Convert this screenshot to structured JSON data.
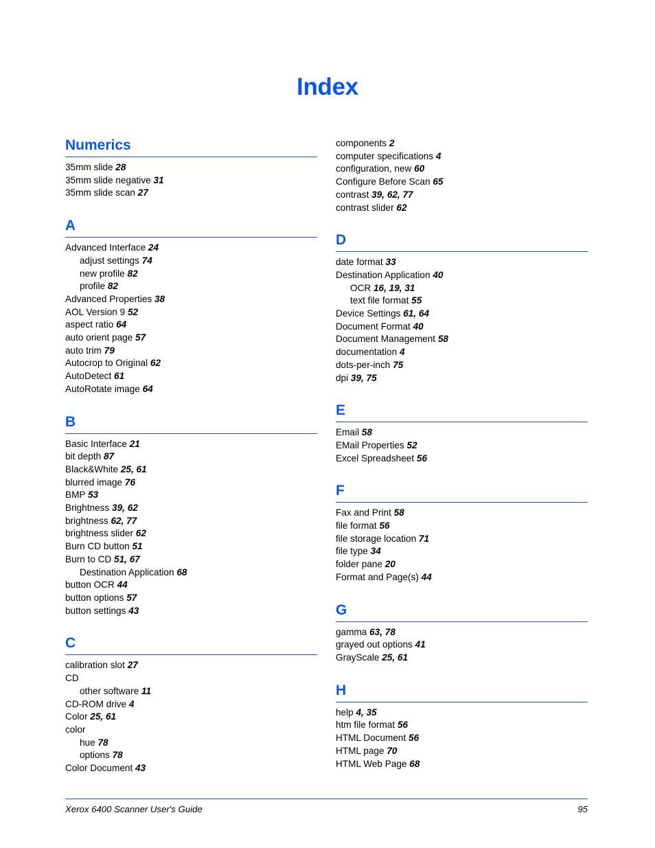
{
  "document": {
    "title": "Index",
    "page_number": "95",
    "footer_text": "Xerox 6400 Scanner User's Guide",
    "accent_color": "#0C57E0",
    "rule_color": "#1056C8",
    "text_color": "#000000"
  },
  "columns": [
    {
      "name": "left-column",
      "sections": [
        {
          "letter": "Numerics",
          "continuation": false,
          "entries": [
            {
              "term": "35mm slide",
              "pages": "28",
              "sub": false
            },
            {
              "term": "35mm slide negative",
              "pages": "31",
              "sub": false
            },
            {
              "term": "35mm slide scan",
              "pages": "27",
              "sub": false
            }
          ]
        },
        {
          "letter": "A",
          "continuation": false,
          "entries": [
            {
              "term": "Advanced Interface",
              "pages": "24",
              "sub": false
            },
            {
              "term": "adjust settings",
              "pages": "74",
              "sub": true
            },
            {
              "term": "new profile",
              "pages": "82",
              "sub": true
            },
            {
              "term": "profile",
              "pages": "82",
              "sub": true
            },
            {
              "term": "Advanced Properties",
              "pages": "38",
              "sub": false
            },
            {
              "term": "AOL Version 9",
              "pages": "52",
              "sub": false
            },
            {
              "term": "aspect ratio",
              "pages": "64",
              "sub": false
            },
            {
              "term": "auto orient page",
              "pages": "57",
              "sub": false
            },
            {
              "term": "auto trim",
              "pages": "79",
              "sub": false
            },
            {
              "term": "Autocrop to Original",
              "pages": "62",
              "sub": false
            },
            {
              "term": "AutoDetect",
              "pages": "61",
              "sub": false
            },
            {
              "term": "AutoRotate image",
              "pages": "64",
              "sub": false
            }
          ]
        },
        {
          "letter": "B",
          "continuation": false,
          "entries": [
            {
              "term": "Basic Interface",
              "pages": "21",
              "sub": false
            },
            {
              "term": "bit depth",
              "pages": "87",
              "sub": false
            },
            {
              "term": "Black&White",
              "pages": "25, 61",
              "sub": false
            },
            {
              "term": "blurred image",
              "pages": "76",
              "sub": false
            },
            {
              "term": "BMP",
              "pages": "53",
              "sub": false
            },
            {
              "term": "Brightness",
              "pages": "39, 62",
              "sub": false
            },
            {
              "term": "brightness",
              "pages": "62, 77",
              "sub": false
            },
            {
              "term": "brightness slider",
              "pages": "62",
              "sub": false
            },
            {
              "term": "Burn CD button",
              "pages": "51",
              "sub": false
            },
            {
              "term": "Burn to CD",
              "pages": "51, 67",
              "sub": false
            },
            {
              "term": "Destination Application",
              "pages": "68",
              "sub": true
            },
            {
              "term": "button OCR",
              "pages": "44",
              "sub": false
            },
            {
              "term": "button options",
              "pages": "57",
              "sub": false
            },
            {
              "term": "button settings",
              "pages": "43",
              "sub": false
            }
          ]
        },
        {
          "letter": "C",
          "continuation": false,
          "entries": [
            {
              "term": "calibration slot",
              "pages": "27",
              "sub": false
            },
            {
              "term": "CD",
              "pages": "",
              "sub": false
            },
            {
              "term": "other software",
              "pages": "11",
              "sub": true
            },
            {
              "term": "CD-ROM drive",
              "pages": "4",
              "sub": false
            },
            {
              "term": "Color",
              "pages": "25, 61",
              "sub": false
            },
            {
              "term": "color",
              "pages": "",
              "sub": false
            },
            {
              "term": "hue",
              "pages": "78",
              "sub": true
            },
            {
              "term": "options",
              "pages": "78",
              "sub": true
            },
            {
              "term": "Color Document",
              "pages": "43",
              "sub": false
            }
          ]
        }
      ]
    },
    {
      "name": "right-column",
      "sections": [
        {
          "letter": "",
          "continuation": true,
          "entries": [
            {
              "term": "components",
              "pages": "2",
              "sub": false
            },
            {
              "term": "computer specifications",
              "pages": "4",
              "sub": false
            },
            {
              "term": "configuration, new",
              "pages": "60",
              "sub": false
            },
            {
              "term": "Configure Before Scan",
              "pages": "65",
              "sub": false
            },
            {
              "term": "contrast",
              "pages": "39, 62, 77",
              "sub": false
            },
            {
              "term": "contrast slider",
              "pages": "62",
              "sub": false
            }
          ]
        },
        {
          "letter": "D",
          "continuation": false,
          "entries": [
            {
              "term": "date format",
              "pages": "33",
              "sub": false
            },
            {
              "term": "Destination Application",
              "pages": "40",
              "sub": false
            },
            {
              "term": "OCR",
              "pages": "16, 19, 31",
              "sub": true
            },
            {
              "term": "text file format",
              "pages": "55",
              "sub": true
            },
            {
              "term": "Device Settings",
              "pages": "61, 64",
              "sub": false
            },
            {
              "term": "Document Format",
              "pages": "40",
              "sub": false
            },
            {
              "term": "Document Management",
              "pages": "58",
              "sub": false
            },
            {
              "term": "documentation",
              "pages": "4",
              "sub": false
            },
            {
              "term": "dots-per-inch",
              "pages": "75",
              "sub": false
            },
            {
              "term": "dpi",
              "pages": "39, 75",
              "sub": false
            }
          ]
        },
        {
          "letter": "E",
          "continuation": false,
          "entries": [
            {
              "term": "Email",
              "pages": "58",
              "sub": false
            },
            {
              "term": "EMail Properties",
              "pages": "52",
              "sub": false
            },
            {
              "term": "Excel Spreadsheet",
              "pages": "56",
              "sub": false
            }
          ]
        },
        {
          "letter": "F",
          "continuation": false,
          "entries": [
            {
              "term": "Fax and Print",
              "pages": "58",
              "sub": false
            },
            {
              "term": "file format",
              "pages": "56",
              "sub": false
            },
            {
              "term": "file storage location",
              "pages": "71",
              "sub": false
            },
            {
              "term": "file type",
              "pages": "34",
              "sub": false
            },
            {
              "term": "folder pane",
              "pages": "20",
              "sub": false
            },
            {
              "term": "Format and Page(s)",
              "pages": "44",
              "sub": false
            }
          ]
        },
        {
          "letter": "G",
          "continuation": false,
          "entries": [
            {
              "term": "gamma",
              "pages": "63, 78",
              "sub": false
            },
            {
              "term": "grayed out options",
              "pages": "41",
              "sub": false
            },
            {
              "term": "GrayScale",
              "pages": "25, 61",
              "sub": false
            }
          ]
        },
        {
          "letter": "H",
          "continuation": false,
          "entries": [
            {
              "term": "help",
              "pages": "4, 35",
              "sub": false
            },
            {
              "term": "htm file format",
              "pages": "56",
              "sub": false
            },
            {
              "term": "HTML Document",
              "pages": "56",
              "sub": false
            },
            {
              "term": "HTML page",
              "pages": "70",
              "sub": false
            },
            {
              "term": "HTML Web Page",
              "pages": "68",
              "sub": false
            }
          ]
        }
      ]
    }
  ]
}
